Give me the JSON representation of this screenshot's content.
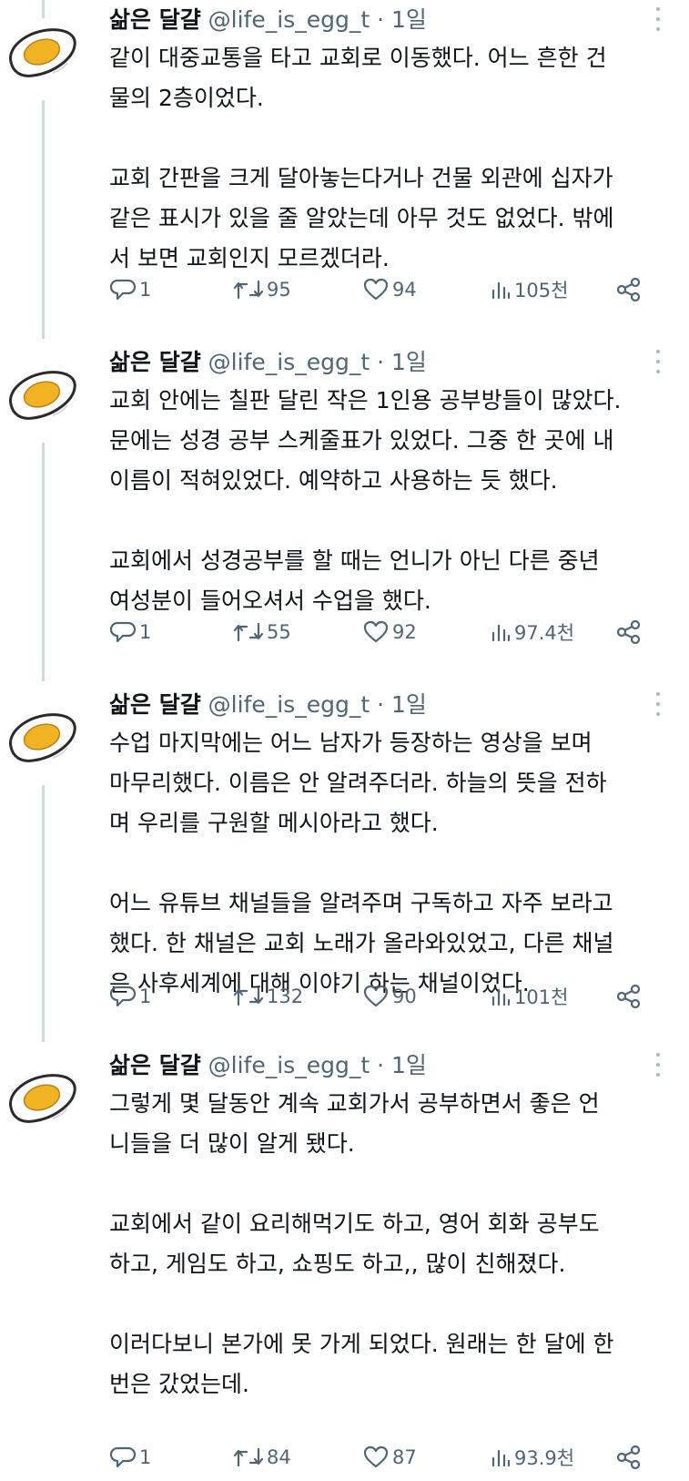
{
  "icons": {
    "avatar": "egg-avatar-icon",
    "more": "more-dots-icon",
    "reply": "reply-icon",
    "retweet": "retweet-icon",
    "like": "heart-icon",
    "views": "views-chart-icon",
    "share": "share-icon"
  },
  "colors": {
    "text": "#0f1419",
    "secondary": "#536471",
    "thread_line": "#cfd9de",
    "egg_yolk": "#f0b323",
    "egg_white": "#ffffff",
    "outline": "#2b2b2b"
  },
  "tweets": [
    {
      "name": "삶은 달걀",
      "handle": "@life_is_egg_t",
      "separator": "·",
      "time": "1일",
      "paragraphs": [
        [
          "같이 대중교통을 타고 교회로 이동했다. 어느 흔한 건",
          "물의 2층이었다."
        ],
        [
          "교회 간판을 크게 달아놓는다거나 건물 외관에 십자가",
          "같은 표시가 있을 줄 알았는데 아무 것도 없었다. 밖에",
          "서 보면 교회인지 모르겠더라."
        ]
      ],
      "replies": "1",
      "retweets": "95",
      "likes": "94",
      "views": "105천"
    },
    {
      "name": "삶은 달걀",
      "handle": "@life_is_egg_t",
      "separator": "·",
      "time": "1일",
      "paragraphs": [
        [
          "교회 안에는 칠판 달린 작은 1인용 공부방들이 많았다.",
          "문에는 성경 공부 스케줄표가 있었다. 그중 한 곳에 내",
          "이름이 적혀있었다. 예약하고 사용하는 듯 했다."
        ],
        [
          "교회에서 성경공부를 할 때는 언니가 아닌 다른 중년",
          "여성분이 들어오셔서 수업을 했다."
        ]
      ],
      "replies": "1",
      "retweets": "55",
      "likes": "92",
      "views": "97.4천"
    },
    {
      "name": "삶은 달걀",
      "handle": "@life_is_egg_t",
      "separator": "·",
      "time": "1일",
      "paragraphs": [
        [
          "수업 마지막에는 어느 남자가 등장하는 영상을 보며",
          "마무리했다. 이름은 안 알려주더라. 하늘의 뜻을 전하",
          "며 우리를 구원할 메시아라고 했다."
        ],
        [
          "어느 유튜브 채널들을 알려주며 구독하고 자주 보라고",
          "했다. 한 채널은 교회 노래가 올라와있었고, 다른 채널",
          "은 사후세계에 대해 이야기 하는 채널이었다."
        ]
      ],
      "replies": "1",
      "retweets": "132",
      "likes": "90",
      "views": "101천"
    },
    {
      "name": "삶은 달걀",
      "handle": "@life_is_egg_t",
      "separator": "·",
      "time": "1일",
      "paragraphs": [
        [
          "그렇게 몇 달동안 계속 교회가서 공부하면서 좋은 언",
          "니들을 더 많이 알게 됐다."
        ],
        [
          "교회에서 같이 요리해먹기도 하고, 영어 회화 공부도",
          "하고, 게임도 하고, 쇼핑도 하고,, 많이 친해졌다."
        ],
        [
          "이러다보니 본가에 못 가게 되었다. 원래는 한 달에 한",
          "번은 갔었는데."
        ]
      ],
      "replies": "1",
      "retweets": "84",
      "likes": "87",
      "views": "93.9천"
    }
  ]
}
